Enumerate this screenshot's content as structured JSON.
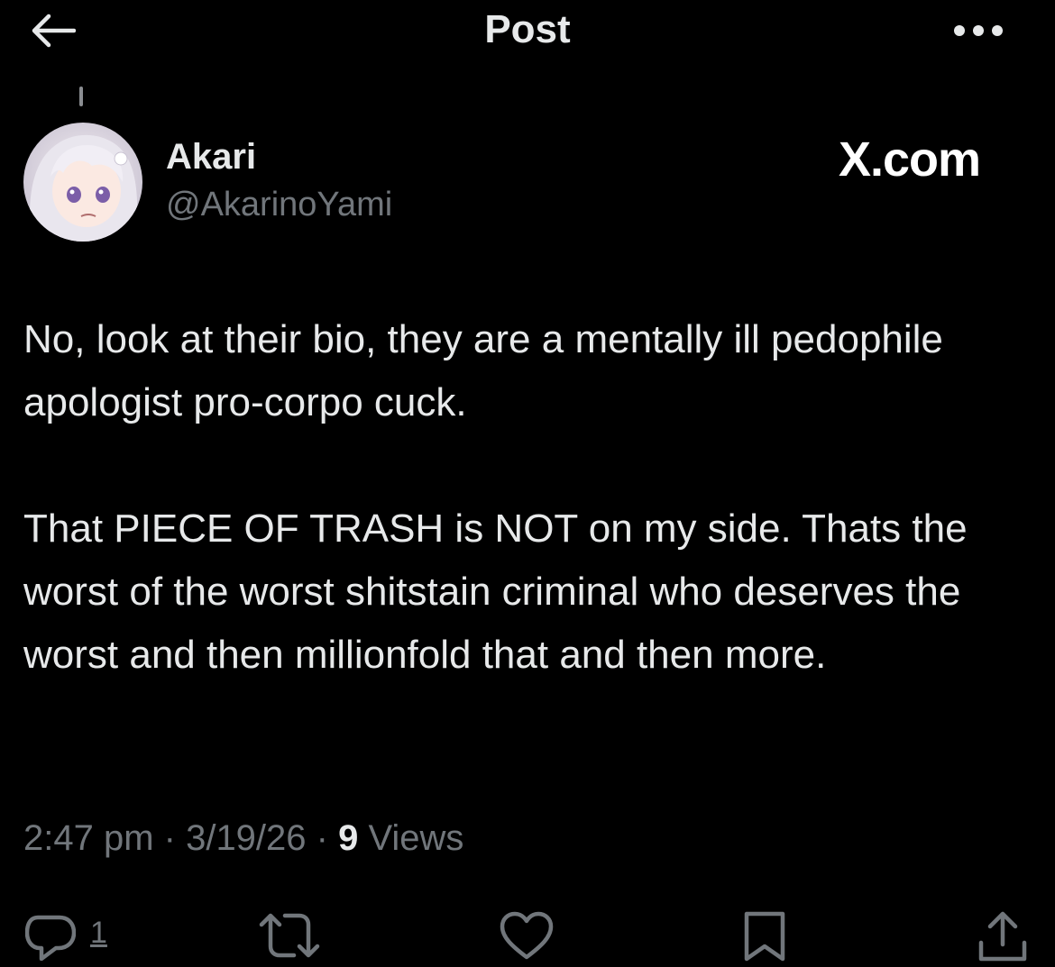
{
  "header": {
    "title": "Post",
    "back_icon": "arrow-left-icon",
    "more_icon": "more-horizontal-icon"
  },
  "author": {
    "display_name": "Akari",
    "handle": "@AkarinoYami",
    "avatar": "anime-character-avatar"
  },
  "watermark": "X.com",
  "post": {
    "paragraphs": [
      "No, look at their bio, they are a mentally ill pedophile apologist pro-corpo cuck.",
      "That PIECE OF TRASH is NOT on my side. Thats the worst of the worst shitstain criminal who deserves the worst and then millionfold that and then more."
    ],
    "time": "2:47 pm",
    "separator": " · ",
    "date": "3/19/26",
    "views_count": "9",
    "views_label": " Views"
  },
  "actions": {
    "reply_count": "1",
    "icons": [
      "reply-icon",
      "repost-icon",
      "like-icon",
      "bookmark-icon",
      "share-icon"
    ]
  },
  "colors": {
    "background": "#000000",
    "text_primary": "#e7e9ea",
    "text_secondary": "#71767b"
  }
}
